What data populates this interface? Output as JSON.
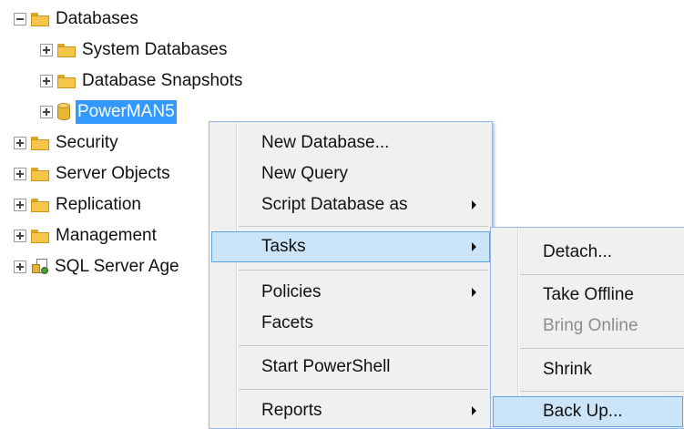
{
  "tree": {
    "databases": "Databases",
    "system_databases": "System Databases",
    "database_snapshots": "Database Snapshots",
    "selected_db": "PowerMAN5",
    "security": "Security",
    "server_objects": "Server Objects",
    "replication": "Replication",
    "management": "Management",
    "sql_server_agent": "SQL Server Age"
  },
  "context_menu": {
    "new_database": "New Database...",
    "new_query": "New Query",
    "script_database_as": "Script Database as",
    "tasks": "Tasks",
    "policies": "Policies",
    "facets": "Facets",
    "start_powershell": "Start PowerShell",
    "reports": "Reports"
  },
  "tasks_submenu": {
    "detach": "Detach...",
    "take_offline": "Take Offline",
    "bring_online": "Bring Online",
    "shrink": "Shrink",
    "back_up": "Back Up..."
  },
  "colors": {
    "selection": "#3399ff",
    "menu_background": "#f0f0f0",
    "menu_highlight": "#cce4f7",
    "menu_highlight_border": "#5ea3e0",
    "disabled_text": "#8c8c8c"
  },
  "icons": {
    "expander": "plus-minus-box-icon",
    "folder": "folder-icon",
    "database": "database-cylinder-icon",
    "agent": "sql-agent-icon",
    "submenu": "chevron-right-icon"
  }
}
